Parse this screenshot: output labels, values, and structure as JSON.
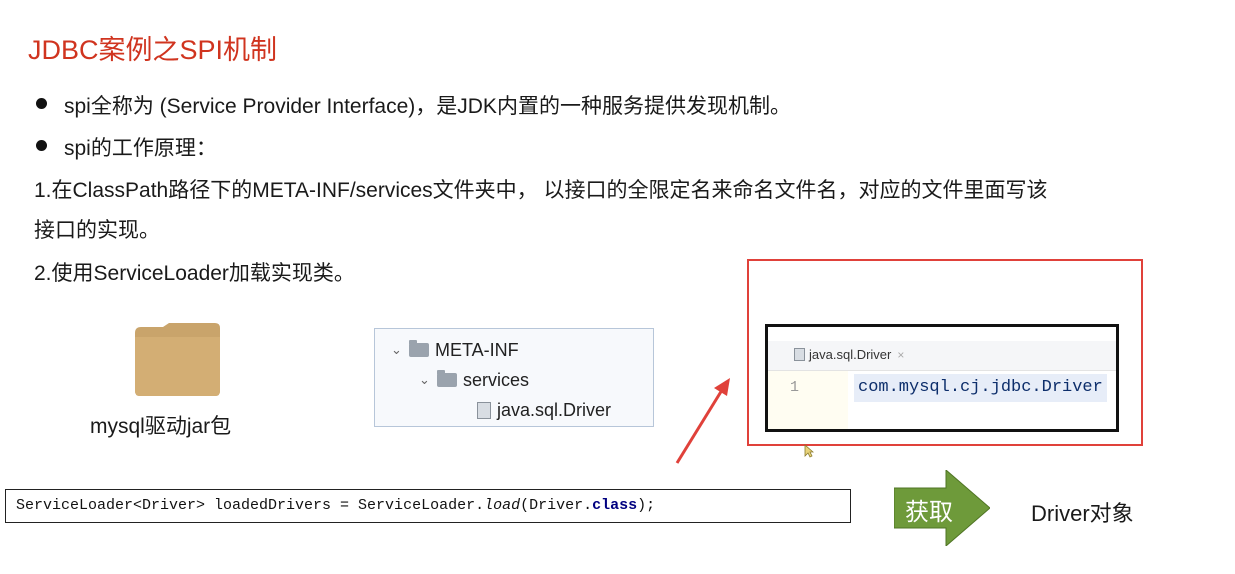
{
  "title": "JDBC案例之SPI机制",
  "bullets": [
    "spi全称为 (Service Provider Interface)，是JDK内置的一种服务提供发现机制。",
    "spi的工作原理："
  ],
  "steps": {
    "step1_line1": "1.在ClassPath路径下的META-INF/services文件夹中， 以接口的全限定名来命名文件名，对应的文件里面写该",
    "step1_line2": "接口的实现。",
    "step2": "2.使用ServiceLoader加载实现类。"
  },
  "jar": {
    "label": "mysql驱动jar包",
    "icon": "folder-icon",
    "color": "#c9a46b"
  },
  "tree": {
    "items": [
      {
        "label": "META-INF",
        "icon": "folder-icon"
      },
      {
        "label": "services",
        "icon": "folder-icon"
      },
      {
        "label": "java.sql.Driver",
        "icon": "file-icon"
      }
    ]
  },
  "editor": {
    "tab_label": "java.sql.Driver",
    "tab_close": "×",
    "line_number": "1",
    "line_content": "com.mysql.cj.jdbc.Driver"
  },
  "code": {
    "part1": "ServiceLoader<Driver> loadedDrivers = ServiceLoader.",
    "method": "load",
    "part2": "(Driver.",
    "keyword": "class",
    "part3": ");"
  },
  "flow": {
    "arrow_label": "获取",
    "arrow_color": "#6e9a3a",
    "result": "Driver对象"
  },
  "colors": {
    "title": "#d0341f",
    "highlight_box": "#e0413a"
  }
}
